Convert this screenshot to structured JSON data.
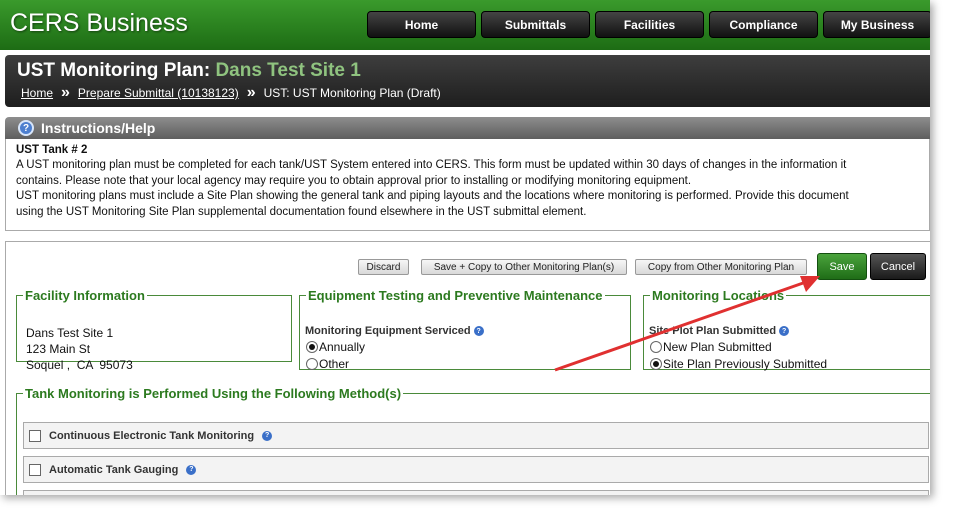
{
  "app": {
    "brand": "CERS Business",
    "nav": [
      "Home",
      "Submittals",
      "Facilities",
      "Compliance",
      "My Business"
    ]
  },
  "page": {
    "title_prefix": "UST Monitoring Plan:",
    "title_site": "Dans Test Site 1",
    "breadcrumb": {
      "home": "Home",
      "prepare": "Prepare Submittal (10138123)",
      "current": "UST: UST Monitoring Plan (Draft)"
    }
  },
  "instructions": {
    "header": "Instructions/Help",
    "tank": "UST Tank # 2",
    "line1": "A UST monitoring plan must be completed for each tank/UST System entered into CERS. This form must be updated within 30 days of changes in the information it",
    "line2": "contains. Please note that your local agency may require you to obtain approval prior to installing or modifying monitoring equipment.",
    "line3": "UST monitoring plans must include a Site Plan showing the general tank and piping layouts and the locations where monitoring is performed. Provide this document",
    "line4": "using the UST Monitoring Site Plan supplemental documentation found elsewhere in the UST submittal element."
  },
  "actions": {
    "discard": "Discard",
    "save_copy": "Save + Copy to Other Monitoring Plan(s)",
    "copy_from": "Copy from Other Monitoring Plan",
    "save": "Save",
    "cancel": "Cancel"
  },
  "facility": {
    "legend": "Facility Information",
    "name": "Dans Test Site 1",
    "street": "123 Main St",
    "city_line": "Soquel ,  CA  95073"
  },
  "equipment": {
    "legend": "Equipment Testing and Preventive Maintenance",
    "label": "Monitoring Equipment Serviced",
    "options": [
      "Annually",
      "Other"
    ],
    "selected": "Annually"
  },
  "monitoring_locations": {
    "legend": "Monitoring Locations",
    "label": "Site Plot Plan Submitted",
    "options": [
      "New Plan Submitted",
      "Site Plan Previously Submitted"
    ],
    "selected": "Site Plan Previously Submitted"
  },
  "methods": {
    "legend": "Tank Monitoring is Performed Using the Following Method(s)",
    "items": [
      "Continuous Electronic Tank Monitoring",
      "Automatic Tank Gauging"
    ]
  },
  "colors": {
    "brand_green": "#2c8a20",
    "legend_green": "#2c7a1f",
    "arrow_red": "#e03030"
  }
}
